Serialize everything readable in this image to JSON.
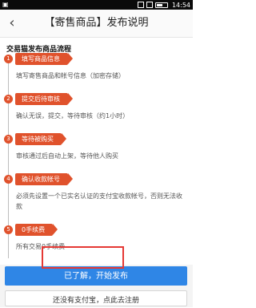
{
  "statusbar": {
    "time": "14:54"
  },
  "header": {
    "title": "【寄售商品】发布说明",
    "back_icon": "chevron-left-icon"
  },
  "flow": {
    "title": "交易猫发布商品流程",
    "steps": [
      {
        "num": "1",
        "tag": "填写商品信息",
        "desc": "填写寄售商品和帐号信息（加密存储）"
      },
      {
        "num": "2",
        "tag": "提交后待审核",
        "desc": "确认无误，提交，等待审核（约1小时）"
      },
      {
        "num": "3",
        "tag": "等待被购买",
        "desc": "审核通过后自动上架，等待他人购买"
      },
      {
        "num": "4",
        "tag": "确认收款帐号",
        "desc": "必须先设置一个已实名认证的支付宝收款帐号，否则无法收款"
      },
      {
        "num": "5",
        "tag": "0手续费",
        "desc": "所有交易0手续费"
      }
    ]
  },
  "buttons": {
    "primary": "已了解，开始发布",
    "secondary": "还没有支付宝，点此去注册"
  },
  "colors": {
    "accent": "#e0522c",
    "primary": "#2f86e6",
    "highlight": "#e53935"
  }
}
